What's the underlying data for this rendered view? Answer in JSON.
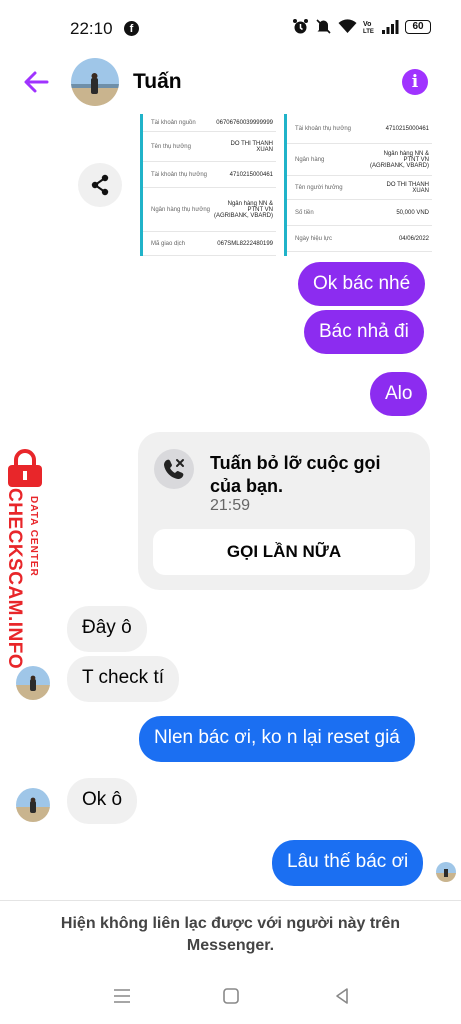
{
  "status_bar": {
    "time": "22:10",
    "fb_glyph": "f",
    "battery": "60"
  },
  "header": {
    "contact_name": "Tuấn",
    "info_glyph": "i"
  },
  "receipt": {
    "left_rows": [
      {
        "label": "Tài khoản nguồn",
        "value": "06706760039999999"
      },
      {
        "label": "Tên thụ hưởng",
        "value": "DO THI THANH XUAN"
      },
      {
        "label": "Tài khoản thụ hưởng",
        "value": "4710215000461"
      },
      {
        "label": "Ngân hàng thụ hưởng",
        "value": "Ngân hàng NN & PTNT VN (AGRIBANK, VBARD)"
      },
      {
        "label": "Mã giao dịch",
        "value": "067SML8222480199"
      }
    ],
    "right_rows": [
      {
        "label": "Tài khoản thụ hưởng",
        "value": "4710215000461"
      },
      {
        "label": "Ngân hàng",
        "value": "Ngân hàng NN & PTNT VN (AGRIBANK, VBARD)"
      },
      {
        "label": "Tên người hưởng",
        "value": "DO THI THANH XUAN"
      },
      {
        "label": "Số tiền",
        "value": "50,000 VND"
      },
      {
        "label": "Ngày hiệu lực",
        "value": "04/06/2022"
      }
    ]
  },
  "messages": {
    "m1": "Ok bác nhé",
    "m2": "Bác nhả đi",
    "m3": "Alo",
    "m4": "Đây ô",
    "m5": "T check tí",
    "m6": "Nlen bác ơi, ko n lại reset giá",
    "m7": "Ok ô",
    "m8": "Lâu thế bác ơi"
  },
  "missed_call": {
    "title": "Tuấn bỏ lỡ cuộc gọi của bạn.",
    "time": "21:59",
    "button": "GỌI LẦN NỮA"
  },
  "watermark": {
    "brand": "CHECKSCAM.INFO",
    "tag": "DATA CENTER"
  },
  "footer": {
    "note": "Hiện không liên lạc được với người này trên Messenger."
  },
  "colors": {
    "accent": "#a033ff",
    "outgoing_purple": "#8c2cf0",
    "outgoing_blue": "#1b6ff2",
    "incoming": "#f0f0f0",
    "watermark": "#e8262a"
  }
}
